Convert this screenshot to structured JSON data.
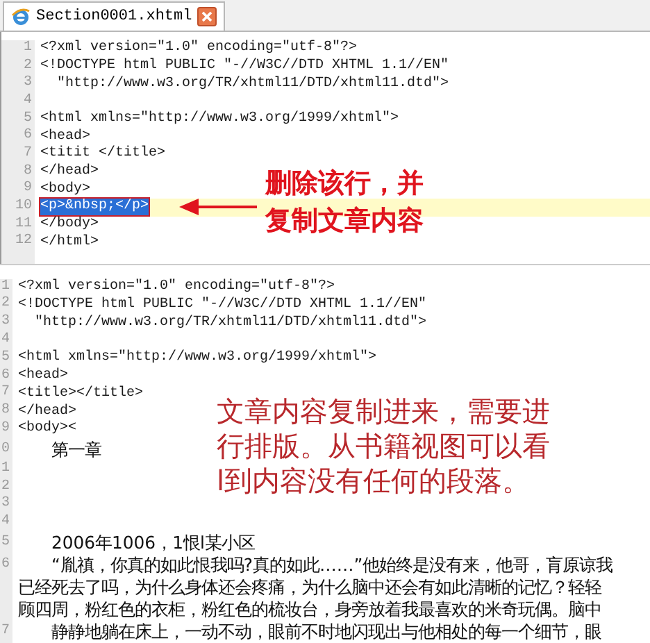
{
  "tab": {
    "title": "Section0001.xhtml"
  },
  "top_editor": {
    "lines": [
      {
        "number": "1",
        "text": "<?xml version=\"1.0\" encoding=\"utf-8\"?>",
        "selected": false
      },
      {
        "number": "2",
        "text": "<!DOCTYPE html PUBLIC \"-//W3C//DTD XHTML 1.1//EN\"",
        "selected": false
      },
      {
        "number": "3",
        "text": "  \"http://www.w3.org/TR/xhtml11/DTD/xhtml11.dtd\">",
        "selected": false
      },
      {
        "number": "4",
        "selected": false
      },
      {
        "number": "5",
        "text": "<html xmlns=\"http://www.w3.org/1999/xhtml\">",
        "selected": false
      },
      {
        "number": "6",
        "text": "<head>",
        "selected": false
      },
      {
        "number": "7",
        "text": "<titit </title>",
        "selected": false
      },
      {
        "number": "8",
        "text": "</head>",
        "selected": false
      },
      {
        "number": "9",
        "text": "<body>",
        "selected": false
      },
      {
        "number": "10",
        "text": "<p>&nbsp;</p>",
        "selected": true
      },
      {
        "number": "11",
        "text": "</body>",
        "selected": false
      },
      {
        "number": "12",
        "text": "</html>",
        "selected": false
      }
    ]
  },
  "top_note": [
    "删除该行，并",
    "复制文章内容"
  ],
  "bottom_editor": {
    "rows": [
      {
        "kind": "code",
        "number": "1",
        "text": "<?xml version=\"1.0\" encoding=\"utf-8\"?>"
      },
      {
        "kind": "code",
        "number": "2",
        "text": "<!DOCTYPE html PUBLIC \"-//W3C//DTD XHTML 1.1//EN\""
      },
      {
        "kind": "code",
        "number": "3",
        "text": "  \"http://www.w3.org/TR/xhtml11/DTD/xhtml11.dtd\">"
      },
      {
        "kind": "code",
        "number": "4"
      },
      {
        "kind": "code",
        "number": "5",
        "text": "<html xmlns=\"http://www.w3.org/1999/xhtml\">"
      },
      {
        "kind": "code",
        "number": "6",
        "text": "<head>"
      },
      {
        "kind": "code",
        "number": "7",
        "text": "<title></title>"
      },
      {
        "kind": "code",
        "number": "8",
        "text": "</head>"
      },
      {
        "kind": "code",
        "number": "9",
        "text": "<body><"
      },
      {
        "kind": "prose",
        "number": "0",
        "text": "　　第一章"
      },
      {
        "kind": "code",
        "number": "1"
      },
      {
        "kind": "code",
        "number": "2"
      },
      {
        "kind": "code",
        "number": "3"
      },
      {
        "kind": "code",
        "number": "4"
      },
      {
        "kind": "prose",
        "number": "5",
        "text": "　　2006年1006，1恨l某小区"
      },
      {
        "kind": "prose",
        "number": "6",
        "text": "　　“胤禛，你真的如此恨我吗?真的如此……”他始终是没有来，他哥，肓原谅我"
      },
      {
        "kind": "prose",
        "text": "已经死去了吗，为什么身体还会疼痛，为什么脑中还会有如此清晰的记忆？轻轻"
      },
      {
        "kind": "prose",
        "text": "顾四周，粉红色的衣柜，粉红色的梳妆台，身旁放着我最喜欢的米奇玩偶。脑中"
      },
      {
        "kind": "prose",
        "number": "7",
        "text": "　　静静地躺在床上，一动不动，眼前不时地闪现出与他相处的每一个细节，眼"
      }
    ]
  },
  "bottom_note": [
    "文章内容复制进来，需要进",
    "行排版。从书籍视图可以看",
    "l到内容没有任何的段落。"
  ]
}
